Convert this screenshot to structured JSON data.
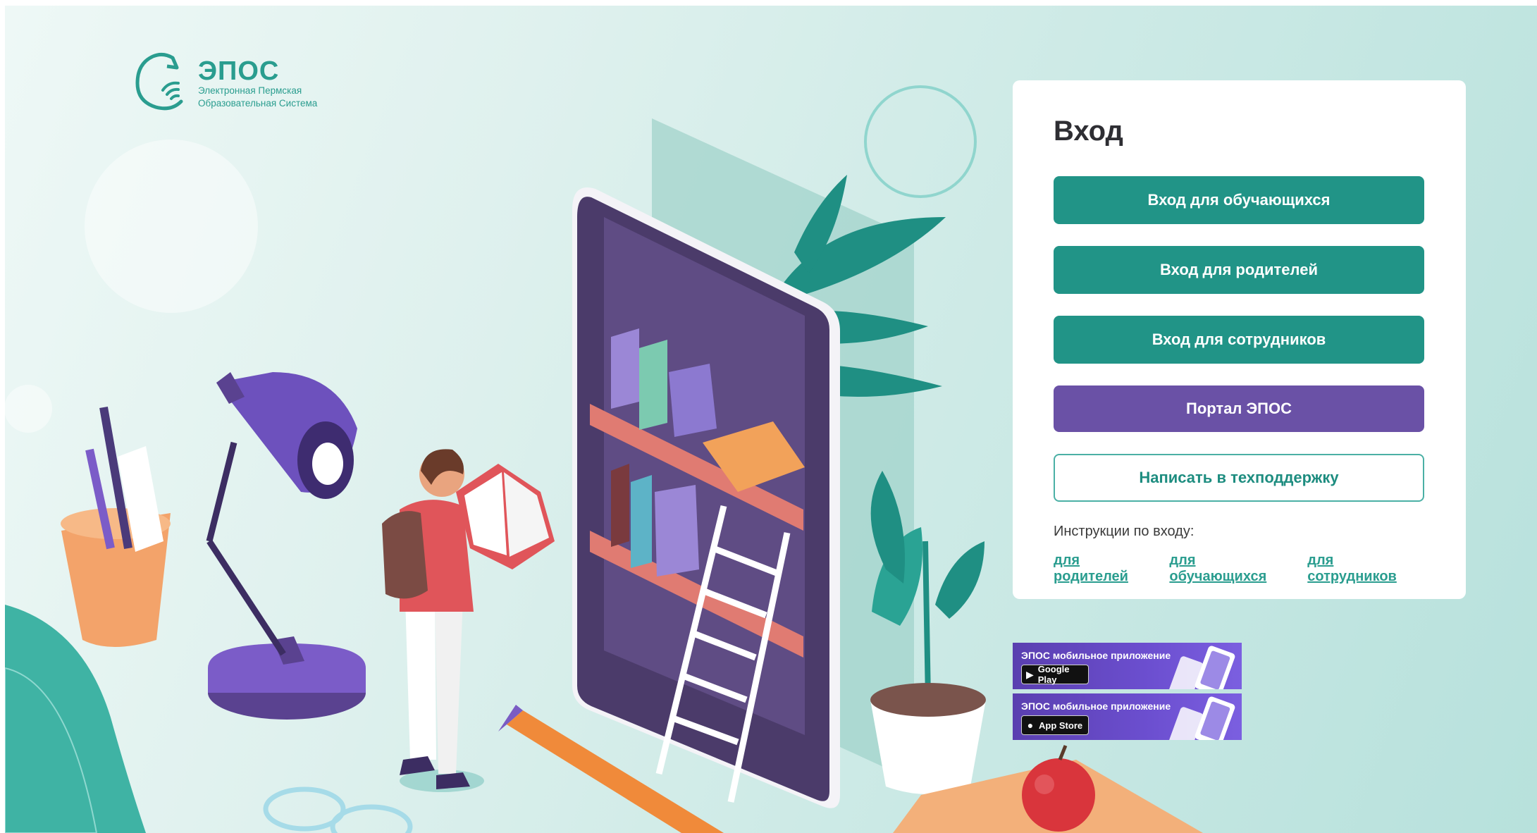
{
  "logo": {
    "name": "ЭПОС",
    "subtitle_line1": "Электронная Пермская",
    "subtitle_line2": "Образовательная Система"
  },
  "login": {
    "title": "Вход",
    "buttons": {
      "students": "Вход для обучающихся",
      "parents": "Вход для родителей",
      "staff": "Вход для сотрудников",
      "portal": "Портал ЭПОС",
      "support": "Написать в техподдержку"
    },
    "instructions_label": "Инструкции по входу:",
    "instruction_links": [
      "для родителей",
      "для обучающихся",
      "для сотрудников"
    ]
  },
  "app_banners": [
    {
      "title": "ЭПОС мобильное приложение",
      "store": "Google Play",
      "store_icon": "google-play-icon"
    },
    {
      "title": "ЭПОС мобильное приложение",
      "store": "App Store",
      "store_icon": "apple-icon"
    }
  ],
  "colors": {
    "teal": "#219487",
    "purple": "#6a51a6",
    "outline_border": "#4bb0a5",
    "link": "#2a9d8f"
  }
}
